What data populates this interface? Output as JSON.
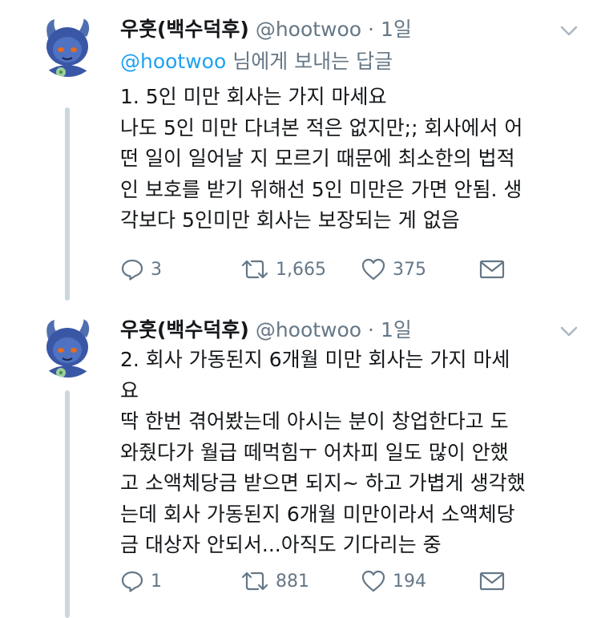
{
  "tweets": [
    {
      "author": "우훗(백수덕후)",
      "handle": "@hootwoo",
      "separator": "·",
      "time": "1일",
      "reply_to": {
        "mention": "@hootwoo",
        "suffix": " 님에게 보내는 답글"
      },
      "lines": [
        "1. 5인 미만 회사는 가지 마세요",
        "나도 5인 미만 다녀본 적은 없지만;; 회사에서 어",
        "떤 일이 일어날 지 모르기 때문에 최소한의 법적",
        "인 보호를 받기 위해선 5인 미만은 가면 안됨. 생",
        "각보다 5인미만 회사는 보장되는 게 없음"
      ],
      "stats": {
        "replies": "3",
        "retweets": "1,665",
        "likes": "375"
      },
      "icons": {
        "menu": "chevron-down-icon",
        "reply": "reply-icon",
        "retweet": "retweet-icon",
        "like": "heart-icon",
        "dm": "envelope-icon"
      }
    },
    {
      "author": "우훗(백수덕후)",
      "handle": "@hootwoo",
      "separator": "·",
      "time": "1일",
      "lines": [
        "2. 회사 가동된지 6개월 미만 회사는 가지 마세",
        "요",
        "딱 한번 겪어봤는데 아시는 분이 창업한다고 도",
        "와줬다가 월급 떼먹힘ㅜ 어차피 일도 많이 안했",
        "고 소액체당금 받으면 되지~ 하고 가볍게 생각했",
        "는데 회사 가동된지 6개월 미만이라서 소액체당",
        "금 대상자 안되서...아직도 기다리는 중"
      ],
      "stats": {
        "replies": "1",
        "retweets": "881",
        "likes": "194"
      },
      "icons": {
        "menu": "chevron-down-icon",
        "reply": "reply-icon",
        "retweet": "retweet-icon",
        "like": "heart-icon",
        "dm": "envelope-icon"
      }
    }
  ],
  "colors": {
    "text": "#14171a",
    "secondary": "#657786",
    "mention": "#1da1f2",
    "thread_line": "#ccd6dd"
  }
}
